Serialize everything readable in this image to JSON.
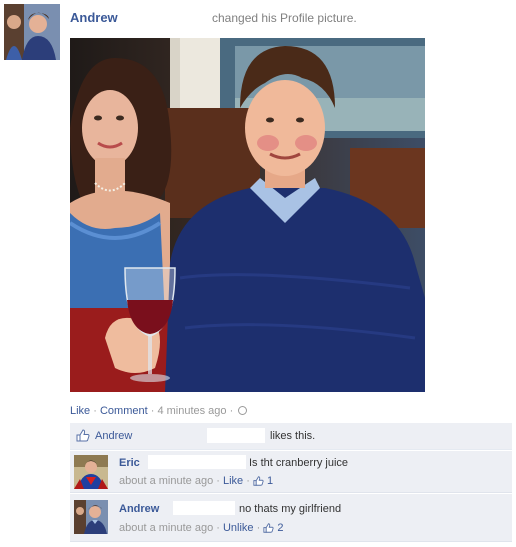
{
  "post": {
    "author": "Andrew",
    "action": "changed his Profile picture.",
    "meta": {
      "like": "Like",
      "sep1": " · ",
      "comment": "Comment",
      "sep2": " · ",
      "time": "4 minutes ago",
      "sep3": " · "
    }
  },
  "likes": {
    "who": "Andrew",
    "text": "likes this."
  },
  "comments": [
    {
      "author": "Eric",
      "text": "Is tht cranberry juice",
      "time": "about a minute ago",
      "sep": " · ",
      "action": "Like",
      "sep2": " · ",
      "like_count": "1"
    },
    {
      "author": "Andrew",
      "text": "no thats my girlfriend",
      "time": "about a minute ago",
      "sep": " · ",
      "action": "Unlike",
      "sep2": " · ",
      "like_count": "2"
    }
  ],
  "colors": {
    "link": "#3b5998",
    "meta_gray": "#999999",
    "comment_bg": "#edeff4"
  }
}
